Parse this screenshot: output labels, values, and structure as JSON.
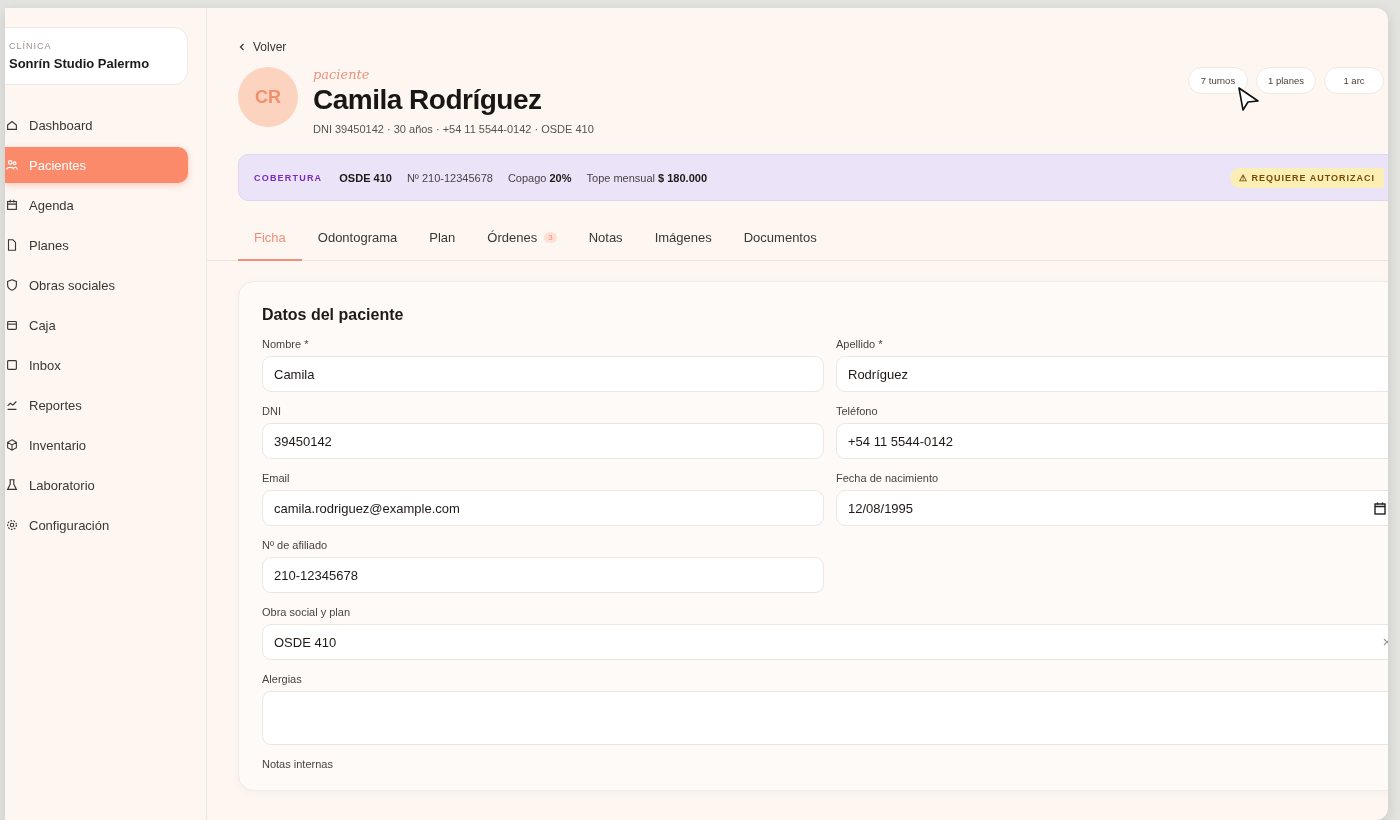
{
  "sidebar": {
    "clinic_label": "CLÍNICA",
    "clinic_name": "Sonrín Studio Palermo",
    "items": [
      {
        "label": "Dashboard",
        "selected": false
      },
      {
        "label": "Pacientes",
        "selected": true
      },
      {
        "label": "Agenda",
        "selected": false
      },
      {
        "label": "Planes",
        "selected": false
      },
      {
        "label": "Obras sociales",
        "selected": false
      },
      {
        "label": "Caja",
        "selected": false
      },
      {
        "label": "Inbox",
        "selected": false
      },
      {
        "label": "Reportes",
        "selected": false
      },
      {
        "label": "Inventario",
        "selected": false
      },
      {
        "label": "Laboratorio",
        "selected": false
      },
      {
        "label": "Configuración",
        "selected": false
      }
    ]
  },
  "header": {
    "back_link": "Volver",
    "avatar_initials": "CR",
    "eyebrow": "paciente",
    "name": "Camila Rodríguez",
    "details": "DNI 39450142 · 30 años · +54 11 5544-0142 · OSDE 410",
    "chips": [
      "7 turnos",
      "1 planes",
      "1 arc"
    ]
  },
  "coverage": {
    "label": "COBERTURA",
    "plan": "OSDE 410",
    "number": "Nº 210-12345678",
    "copay": "Copago **20%**",
    "cap": "Tope mensual **$ 180.000**",
    "warning": "⚠ REQUIERE AUTORIZACI"
  },
  "tabs": [
    {
      "label": "Ficha",
      "selected": true
    },
    {
      "label": "Odontograma",
      "selected": false
    },
    {
      "label": "Plan",
      "selected": false
    },
    {
      "label": "Órdenes",
      "selected": false,
      "badge": "3"
    },
    {
      "label": "Notas",
      "selected": false
    },
    {
      "label": "Imágenes",
      "selected": false
    },
    {
      "label": "Documentos",
      "selected": false
    }
  ],
  "form": {
    "title": "Datos del paciente",
    "fields": [
      {
        "label": "Nombre *",
        "value": "Camila",
        "kind": "text"
      },
      {
        "label": "Apellido *",
        "value": "Rodríguez",
        "kind": "text"
      },
      {
        "label": "DNI",
        "value": "39450142",
        "kind": "text"
      },
      {
        "label": "Teléfono",
        "value": "+54 11 5544-0142",
        "kind": "text"
      },
      {
        "label": "Email",
        "value": "camila.rodriguez@example.com",
        "kind": "text"
      },
      {
        "label": "Fecha de nacimiento",
        "value": "12/08/1995",
        "kind": "date"
      },
      {
        "label": "Nº de afiliado",
        "value": "210-12345678",
        "kind": "text"
      },
      {
        "label": "Obra social y plan",
        "value": "OSDE 410",
        "kind": "select"
      },
      {
        "label": "Alergias",
        "kind": "textarea"
      },
      {
        "label": "Notas internas",
        "kind": "label"
      }
    ]
  }
}
